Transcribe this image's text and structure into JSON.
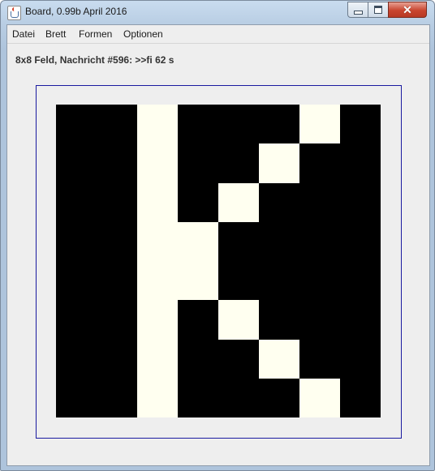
{
  "window": {
    "title": "Board, 0.99b April 2016",
    "icon": "java-icon",
    "controls": {
      "minimize": "minimize-icon",
      "maximize": "maximize-icon",
      "close": "✕"
    }
  },
  "menu": {
    "items": [
      {
        "label": "Datei"
      },
      {
        "label": "Brett"
      },
      {
        "label": "Formen"
      },
      {
        "label": "Optionen"
      }
    ]
  },
  "status": {
    "text": "8x8 Feld, Nachricht #596: >>fi 62 s"
  },
  "board": {
    "size": 8,
    "colors": {
      "on": "#000000",
      "off": "#fffff0",
      "frame": "#1a1aa0"
    },
    "rows": [
      "BBWBBBWB",
      "BBWBBWBB",
      "BBWBWBBB",
      "BBWWBBBB",
      "BBWWBBBB",
      "BBWBWBBB",
      "BBWBBWBB",
      "BBWBBBWB"
    ]
  }
}
